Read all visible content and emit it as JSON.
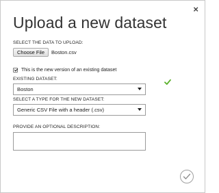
{
  "dialog": {
    "title": "Upload a new dataset",
    "close_glyph": "×"
  },
  "upload": {
    "label": "SELECT THE DATA TO UPLOAD:",
    "button_label": "Choose File",
    "file_name": "Boston.csv"
  },
  "new_version": {
    "checked": true,
    "label": "This is the new version of an existing dataset"
  },
  "existing_dataset": {
    "label": "EXISTING DATASET:",
    "selected_value": "Boston",
    "valid_icon": "check-mark-icon",
    "valid_color": "#5ab02a"
  },
  "dataset_type": {
    "label": "SELECT A TYPE FOR THE NEW DATASET:",
    "selected_value": "Generic CSV File with a header (.csv)"
  },
  "description": {
    "label": "PROVIDE AN OPTIONAL DESCRIPTION:",
    "value": ""
  },
  "ok": {
    "icon": "checkmark-circle-icon",
    "color": "#a0a0a0"
  }
}
